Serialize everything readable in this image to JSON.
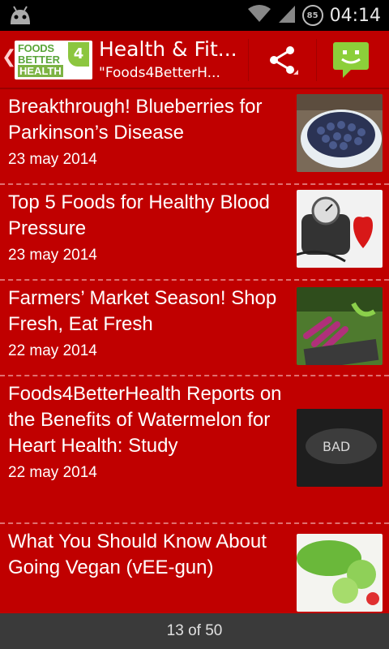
{
  "status_bar": {
    "time": "04:14",
    "battery": "85",
    "icons": [
      "android-icon",
      "wifi-icon",
      "signal-icon",
      "battery-icon"
    ]
  },
  "action_bar": {
    "logo": {
      "line1": "FOODS",
      "line2": "BETTER",
      "line3": "HEALTH",
      "number": "4"
    },
    "title": "Health & Fit...",
    "subtitle": "\"Foods4BetterH...",
    "actions": [
      "share-icon",
      "chat-icon"
    ],
    "accent": "#c00000"
  },
  "articles": [
    {
      "headline": "Breakthrough! Blueberries for Parkinson’s Disease",
      "date": "23 may 2014",
      "thumb": "blueberries-image"
    },
    {
      "headline": "Top 5 Foods for Healthy Blood Pressure",
      "date": "23 may 2014",
      "thumb": "blood-pressure-image"
    },
    {
      "headline": "Farmers’ Market Season! Shop Fresh, Eat Fresh",
      "date": "22 may 2014",
      "thumb": "farmers-market-image"
    },
    {
      "headline": "Foods4BetterHealth Reports on the Benefits of Watermelon for Heart Health: Study",
      "date": "22 may 2014",
      "thumb": "bad-image",
      "thumb_text": "BAD"
    },
    {
      "headline": "What You Should Know About Going Vegan (vEE-gun)",
      "date": "",
      "thumb": "vegan-image"
    }
  ],
  "pager": {
    "label": "13 of 50"
  }
}
